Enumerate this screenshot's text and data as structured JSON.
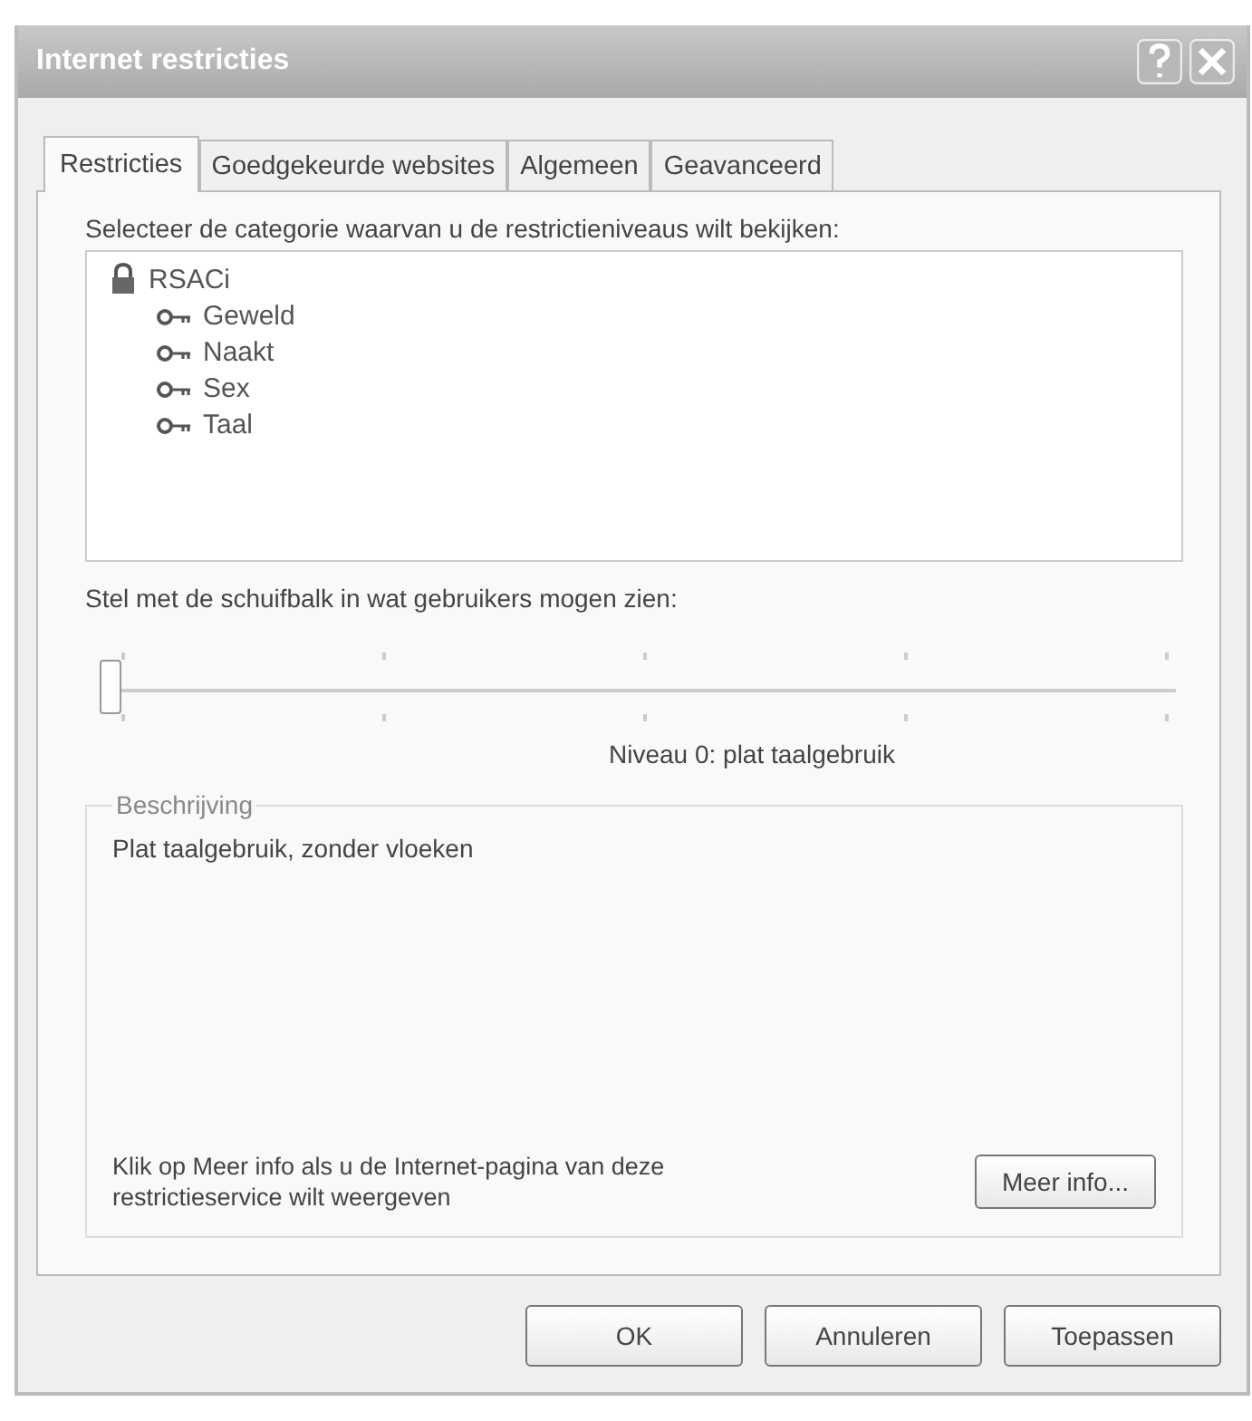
{
  "window": {
    "title": "Internet restricties"
  },
  "tabs": [
    {
      "label": "Restricties",
      "selected": true
    },
    {
      "label": "Goedgekeurde websites",
      "selected": false
    },
    {
      "label": "Algemeen",
      "selected": false
    },
    {
      "label": "Geavanceerd",
      "selected": false
    }
  ],
  "category_prompt": "Selecteer de categorie waarvan u de restrictieniveaus wilt bekijken:",
  "tree": [
    {
      "label": "RSACi",
      "children": [
        {
          "label": "Geweld"
        },
        {
          "label": "Naakt"
        },
        {
          "label": "Sex"
        },
        {
          "label": "Taal"
        }
      ]
    }
  ],
  "slider_prompt": "Stel met de schuifbalk in wat gebruikers mogen zien:",
  "slider": {
    "level": 0
  },
  "level_text": "Niveau 0: plat taalgebruik",
  "description": {
    "legend": "Beschrijving",
    "text": "Plat taalgebruik, zonder vloeken",
    "info_text": "Klik op Meer info als u de Internet-pagina van deze restrictieservice wilt weergeven",
    "info_button": "Meer info..."
  },
  "buttons": [
    "OK",
    "Annuleren",
    "Toepassen"
  ]
}
